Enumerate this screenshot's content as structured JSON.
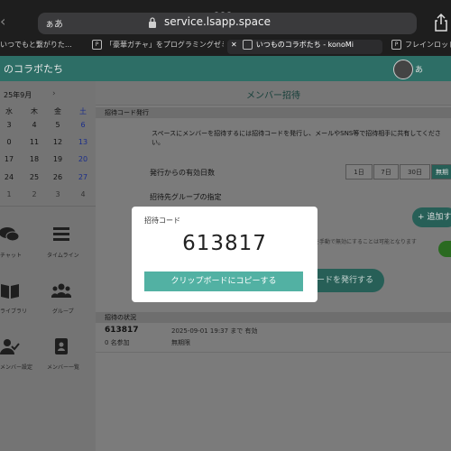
{
  "browser": {
    "url_left": "ぁあ",
    "url": "service.lsapp.space",
    "tabs": [
      {
        "label": "いつでもと繋がりた…",
        "icon": "",
        "active": false
      },
      {
        "label": "「豪華ガチャ」をプログラミングゼミ・…",
        "icon": "P",
        "active": false
      },
      {
        "label": "いつものコラボたち - konoMi",
        "icon": "",
        "active": true
      },
      {
        "label": "フレインロッド?",
        "icon": "P",
        "active": false
      }
    ]
  },
  "app": {
    "title": "のコラボたち",
    "user_label": "あ"
  },
  "calendar": {
    "month": "25年9月",
    "next": "›",
    "weekdays": [
      "水",
      "木",
      "金",
      "土"
    ],
    "weeks": [
      [
        "3",
        "4",
        "5",
        "6"
      ],
      [
        "0",
        "11",
        "12",
        "13"
      ],
      [
        "17",
        "18",
        "19",
        "20"
      ],
      [
        "24",
        "25",
        "26",
        "27"
      ],
      [
        "1",
        "2",
        "3",
        "4"
      ]
    ]
  },
  "sidebar": {
    "items": [
      {
        "label": "チャット",
        "icon": "chat-icon"
      },
      {
        "label": "タイムライン",
        "icon": "timeline-icon"
      },
      {
        "label": "ライブラリ",
        "icon": "book-icon"
      },
      {
        "label": "グループ",
        "icon": "group-icon"
      },
      {
        "label": "メンバー設定",
        "icon": "member-check-icon"
      },
      {
        "label": "メンバー一覧",
        "icon": "address-book-icon"
      }
    ]
  },
  "main": {
    "title": "メンバー招待",
    "section_issue": "招待コード発行",
    "description": "スペースにメンバーを招待するには招待コードを発行し、メールやSNS等で招待相手に共有してください。",
    "days_label": "発行からの有効日数",
    "day_options": [
      "1日",
      "7日",
      "30日",
      "無期"
    ],
    "selected_day_index": 3,
    "group_label": "招待先グループの指定",
    "add_button": "+ 追加す",
    "hidden_note": "発行を手動で無効にすることは可能となります",
    "issue_button": "コードを発行する",
    "section_status": "招待の状況",
    "status_rows": [
      {
        "code": "613817",
        "date": "2025-09-01 19:37 まで 有効",
        "count": "0 名参加",
        "status": "無期限"
      }
    ]
  },
  "popup": {
    "label": "招待コード",
    "code": "613817",
    "copy_button": "クリップボードにコピーする"
  }
}
